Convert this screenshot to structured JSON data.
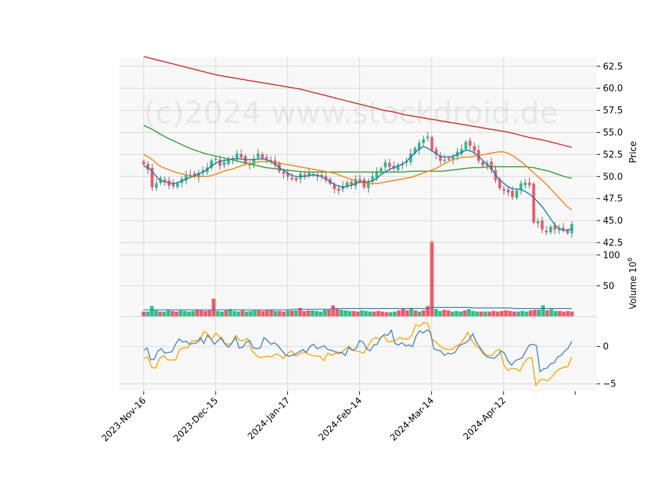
{
  "chart_data": {
    "type": "candlestick",
    "watermark": "(c)2024 www.stockdroid.de",
    "date_range": [
      "2023-11-16",
      "2024-04-30"
    ],
    "x_ticks": [
      "2023-Nov-16",
      "2023-Dec-15",
      "2024-Jan-17",
      "2024-Feb-14",
      "2024-Mar-14",
      "2024-Apr-12"
    ],
    "colors": {
      "up": "#2ebf8a",
      "down": "#f05a68",
      "sma5": "#1f77b4",
      "sma10": "#ff7f0e",
      "sma20": "#2ca02c",
      "sma100": "#d62728",
      "osc1": "#4a86c0",
      "osc2": "#ffa500"
    },
    "price_panel": {
      "ylabel": "Price",
      "ylim": [
        42.5,
        63.5
      ],
      "yticks": [
        "42.5",
        "45.0",
        "47.5",
        "50.0",
        "52.5",
        "55.0",
        "57.5",
        "60.0",
        "62.5"
      ],
      "close": [
        51.4,
        50.8,
        48.8,
        49.2,
        49.8,
        49.5,
        49.0,
        48.9,
        49.2,
        49.7,
        50.2,
        50.2,
        50.0,
        50.4,
        50.7,
        51.0,
        51.8,
        52.0,
        51.2,
        51.6,
        52.0,
        51.9,
        52.6,
        52.2,
        51.5,
        51.4,
        52.0,
        52.6,
        52.1,
        52.0,
        51.8,
        51.3,
        50.6,
        50.3,
        50.0,
        49.8,
        49.6,
        50.3,
        50.1,
        50.4,
        50.2,
        50.0,
        50.1,
        49.6,
        49.2,
        48.6,
        48.4,
        48.9,
        49.3,
        49.1,
        49.7,
        49.5,
        48.8,
        49.4,
        50.0,
        50.5,
        50.9,
        51.6,
        51.1,
        50.9,
        51.3,
        51.4,
        51.7,
        52.6,
        53.2,
        53.8,
        54.2,
        54.5,
        53.0,
        52.5,
        51.8,
        51.9,
        52.0,
        52.2,
        52.8,
        53.1,
        53.9,
        53.5,
        52.9,
        51.8,
        51.3,
        51.5,
        50.8,
        49.6,
        48.7,
        48.5,
        48.2,
        47.7,
        48.4,
        49.2,
        49.3,
        49.0,
        44.8,
        44.9,
        44.0,
        43.7,
        44.3,
        44.0,
        44.1,
        44.0,
        43.6,
        44.6
      ],
      "sma5": [
        51.2,
        51.0,
        50.6,
        50.0,
        49.5,
        49.4,
        49.3,
        49.2,
        49.3,
        49.5,
        49.7,
        49.9,
        50.1,
        50.3,
        50.5,
        50.8,
        51.2,
        51.5,
        51.7,
        51.8,
        51.9,
        52.0,
        52.0,
        52.0,
        51.9,
        51.9,
        51.9,
        52.0,
        52.0,
        51.9,
        51.7,
        51.4,
        51.0,
        50.7,
        50.4,
        50.1,
        50.0,
        50.0,
        50.0,
        50.1,
        50.2,
        50.1,
        50.0,
        49.7,
        49.4,
        49.1,
        48.9,
        48.8,
        48.9,
        49.0,
        49.2,
        49.4,
        49.4,
        49.4,
        49.5,
        49.8,
        50.2,
        50.5,
        50.8,
        51.0,
        51.2,
        51.4,
        51.7,
        52.2,
        52.7,
        53.1,
        53.4,
        53.2,
        52.9,
        52.6,
        52.3,
        52.2,
        52.2,
        52.3,
        52.5,
        52.7,
        53.0,
        52.9,
        52.7,
        52.3,
        51.8,
        51.4,
        50.9,
        50.2,
        49.6,
        49.2,
        48.8,
        48.6,
        48.6,
        48.5,
        48.3,
        48.0,
        47.6,
        47.1,
        46.6,
        45.9,
        45.2,
        44.5,
        44.1,
        43.9,
        43.9,
        44.1
      ],
      "sma10": [
        52.5,
        52.2,
        51.8,
        51.3,
        51.0,
        50.8,
        50.6,
        50.4,
        50.3,
        50.1,
        50.0,
        50.0,
        50.0,
        50.0,
        50.1,
        50.3,
        50.5,
        50.7,
        50.8,
        51.0,
        51.2,
        51.4,
        51.5,
        51.6,
        51.7,
        51.7,
        51.7,
        51.6,
        51.5,
        51.4,
        51.3,
        51.2,
        51.1,
        51.0,
        50.9,
        50.8,
        50.7,
        50.6,
        50.5,
        50.4,
        50.2,
        50.0,
        49.8,
        49.6,
        49.4,
        49.3,
        49.2,
        49.2,
        49.2,
        49.3,
        49.4,
        49.5,
        49.6,
        49.7,
        49.8,
        49.9,
        50.1,
        50.3,
        50.5,
        50.7,
        50.9,
        51.2,
        51.5,
        51.8,
        52.0,
        52.1,
        52.2,
        52.2,
        52.3,
        52.4,
        52.5,
        52.6,
        52.7,
        52.8,
        52.8,
        52.6,
        52.3,
        51.9,
        51.5,
        51.0,
        50.5,
        50.0,
        49.5,
        49.0,
        48.4,
        47.8,
        47.2,
        46.6,
        46.2
      ],
      "sma20": [
        55.8,
        55.4,
        54.9,
        54.4,
        54.0,
        53.6,
        53.2,
        52.9,
        52.6,
        52.4,
        52.2,
        52.0,
        51.8,
        51.6,
        51.4,
        51.2,
        51.0,
        50.9,
        50.8,
        50.7,
        50.6,
        50.5,
        50.5,
        50.5,
        50.5,
        50.5,
        50.5,
        50.5,
        50.5,
        50.5,
        50.5,
        50.5,
        50.5,
        50.5,
        50.5,
        50.6,
        50.6,
        50.6,
        50.6,
        50.6,
        50.7,
        50.8,
        50.9,
        51.0,
        51.0,
        51.1,
        51.1,
        51.1,
        51.1,
        51.1,
        51.1,
        51.0,
        50.8,
        50.6,
        50.3,
        50.0,
        49.8
      ],
      "sma100": [
        63.6,
        63.3,
        63.0,
        62.7,
        62.4,
        62.1,
        61.8,
        61.5,
        61.3,
        61.1,
        60.9,
        60.7,
        60.5,
        60.3,
        60.1,
        59.9,
        59.6,
        59.3,
        59.0,
        58.7,
        58.4,
        58.1,
        57.8,
        57.5,
        57.3,
        57.0,
        56.8,
        56.6,
        56.4,
        56.2,
        56.0,
        55.8,
        55.6,
        55.4,
        55.2,
        55.0,
        54.7,
        54.4,
        54.2,
        53.9,
        53.6,
        53.3
      ]
    },
    "volume_panel": {
      "ylabel": "Volume  10^6",
      "ylim": [
        0,
        120
      ],
      "yticks": [
        "50",
        "100"
      ],
      "values": [
        8,
        8,
        17,
        10,
        8,
        8,
        11,
        9,
        8,
        10,
        9,
        8,
        9,
        11,
        10,
        9,
        10,
        29,
        9,
        8,
        10,
        12,
        9,
        8,
        10,
        8,
        9,
        10,
        10,
        9,
        10,
        11,
        9,
        9,
        8,
        10,
        10,
        10,
        14,
        9,
        10,
        10,
        9,
        8,
        11,
        11,
        18,
        13,
        11,
        10,
        9,
        9,
        8,
        10,
        9,
        8,
        8,
        9,
        8,
        7,
        7,
        8,
        10,
        13,
        10,
        14,
        10,
        8,
        10,
        17,
        122,
        12,
        9,
        11,
        10,
        8,
        9,
        8,
        10,
        12,
        9,
        8,
        8,
        8,
        8,
        9,
        8,
        9,
        10,
        9,
        8,
        8,
        9,
        8,
        10,
        11,
        11,
        18,
        10,
        12,
        9,
        9,
        8,
        9,
        8
      ],
      "avg": [
        11,
        11,
        11,
        11,
        11,
        11,
        11,
        11,
        11,
        11,
        11,
        11,
        11,
        11,
        11,
        11,
        11,
        11,
        11,
        11,
        11,
        11,
        11,
        11,
        11,
        11,
        11,
        11,
        11,
        11,
        11,
        11,
        11,
        11,
        11,
        11,
        12,
        12,
        12,
        12,
        12,
        12,
        12,
        12,
        12,
        12,
        13,
        13,
        13,
        13,
        13,
        13,
        13,
        13,
        13,
        13,
        13,
        13,
        13,
        13,
        13,
        13,
        13,
        13,
        13,
        13,
        13,
        13,
        13,
        13,
        15,
        15,
        15,
        15,
        15,
        15,
        15,
        15,
        15,
        15,
        14,
        14,
        14,
        14,
        14,
        14,
        14,
        14,
        14,
        14,
        13,
        13,
        13,
        13,
        13,
        13,
        13,
        13,
        13,
        13,
        13,
        13,
        13,
        13,
        13
      ]
    },
    "oscillator_panel": {
      "ylim": [
        -6,
        4
      ],
      "yticks": [
        "0",
        "−5"
      ],
      "series1": [
        -0.5,
        -0.2,
        -1.8,
        -1.7,
        -0.6,
        -0.3,
        -0.9,
        -0.8,
        -0.7,
        0.3,
        1.0,
        0.6,
        0.7,
        0.3,
        0.4,
        0.5,
        1.2,
        0.4,
        1.5,
        1.0,
        0.3,
        0.8,
        1.2,
        0.3,
        -0.1,
        0.5,
        1.2,
        -0.2,
        -0.1,
        0.6,
        0.8,
        -0.2,
        -0.3,
        -0.2,
        1.2,
        0.8,
        0.3,
        0.5,
        0.1,
        -0.5,
        -1.1,
        -1.3,
        -1.2,
        -1.0,
        -0.7,
        -0.4,
        -0.8,
        0.0,
        0.3,
        -0.3,
        -0.1,
        0.1,
        -0.4,
        -0.5,
        -0.7,
        -0.8,
        -0.8,
        -1.2,
        0.0,
        -0.5,
        -0.3,
        0.8,
        0.6,
        -0.3,
        -0.6,
        0.2,
        0.3,
        1.2,
        1.6,
        1.5,
        2.2,
        0.4,
        0.2,
        0.5,
        0.1,
        0.2,
        0.0,
        1.4,
        2.1,
        1.8,
        2.2,
        2.0,
        -0.3,
        -0.5,
        -0.6,
        -1.2,
        -0.9,
        -1.0,
        -0.8,
        0.0,
        0.3,
        0.5,
        0.9,
        1.7,
        0.6,
        -0.1,
        -0.8,
        -1.4,
        -1.5,
        -1.6,
        -1.2,
        -0.6,
        -0.9,
        -2.0,
        -2.5,
        -1.9,
        -1.7,
        -1.5,
        -0.6,
        0.2,
        0.3,
        0.1,
        -3.4,
        -3.0,
        -2.9,
        -2.3,
        -2.2,
        -1.4,
        -1.2,
        -0.6,
        -0.2,
        0.7
      ],
      "series2": [
        -1.6,
        -1.4,
        -2.8,
        -2.9,
        -1.6,
        -1.2,
        -1.8,
        -1.8,
        -1.8,
        -0.4,
        -0.2,
        -0.2,
        0.7,
        0.8,
        0.7,
        2.0,
        1.7,
        0.9,
        1.8,
        1.3,
        0.5,
        0.3,
        0.4,
        1.5,
        0.8,
        0.8,
        1.1,
        -0.5,
        -1.1,
        -1.5,
        -1.4,
        -1.3,
        -1.4,
        -1.0,
        -1.2,
        -1.6,
        -0.9,
        -0.6,
        -1.3,
        -1.0,
        -0.7,
        -1.0,
        -1.2,
        -1.3,
        -1.3,
        -1.9,
        -0.9,
        -1.2,
        -0.9,
        -1.0,
        -0.5,
        -0.1,
        -0.5,
        -0.6,
        -0.7,
        -0.9,
        0.0,
        0.9,
        1.2,
        1.0,
        1.5,
        0.6,
        0.7,
        0.8,
        1.2,
        1.0,
        1.0,
        1.5,
        2.9,
        2.7,
        3.2,
        3.1,
        1.0,
        0.6,
        0.1,
        -0.3,
        -0.4,
        -0.4,
        0.0,
        0.3,
        1.0,
        1.9,
        0.8,
        0.1,
        -0.3,
        -1.1,
        -1.2,
        -1.2,
        -0.6,
        -0.4,
        -2.5,
        -3.2,
        -2.9,
        -3.0,
        -3.3,
        -2.2,
        -1.6,
        -1.5,
        -5.2,
        -4.5,
        -4.4,
        -4.6,
        -4.1,
        -3.4,
        -3.0,
        -2.8,
        -2.7,
        -1.4
      ]
    }
  }
}
